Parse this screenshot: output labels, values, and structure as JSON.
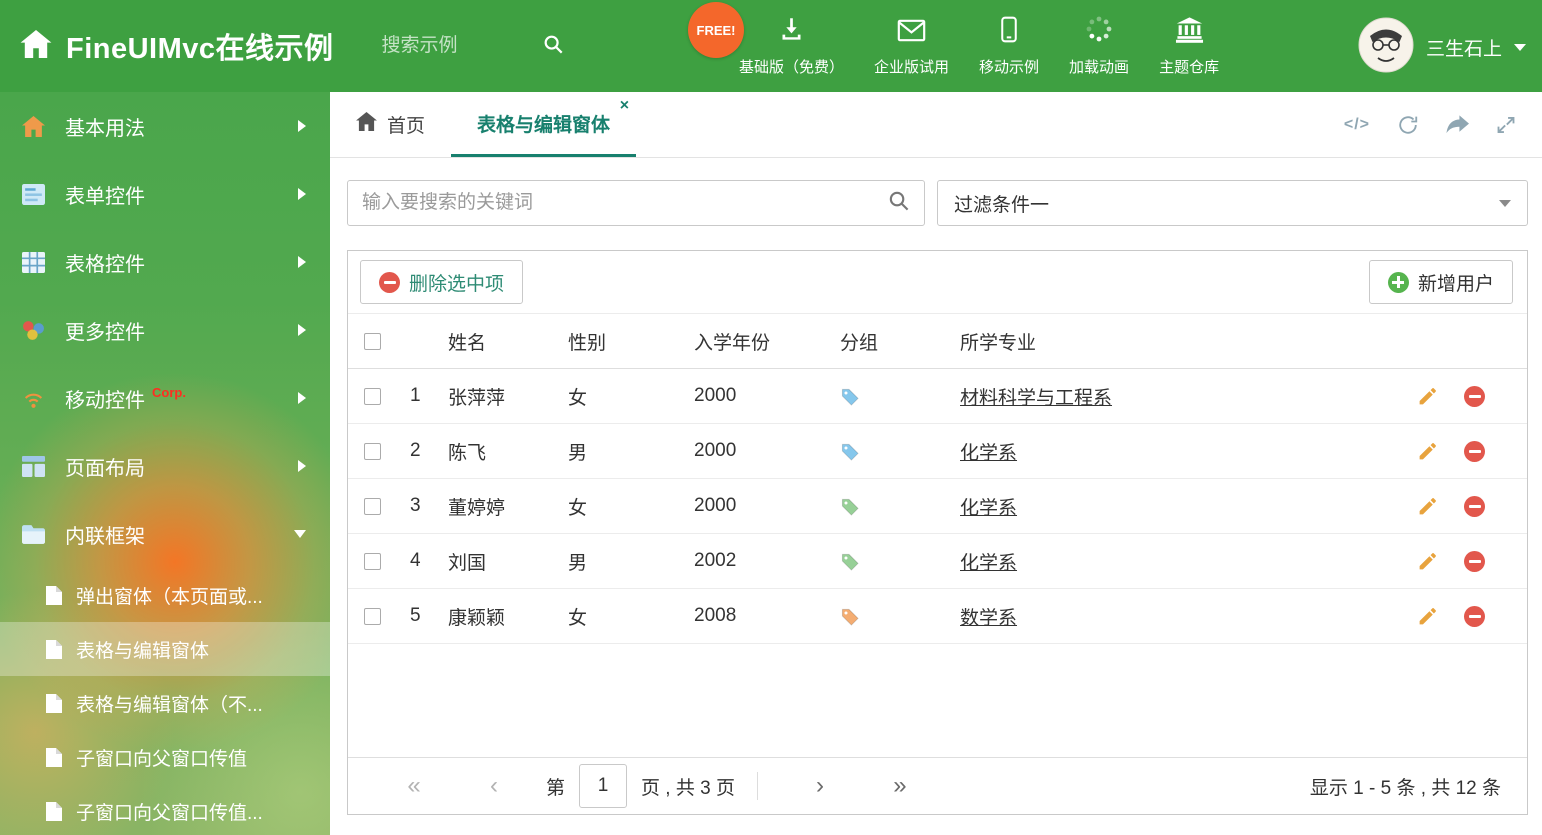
{
  "colors": {
    "header_green": "#3ea041",
    "accent_teal": "#18806e",
    "tag_blue": "#85c7ec",
    "tag_green": "#97d097",
    "tag_orange": "#f4ad72",
    "free_badge_orange": "#f4672b"
  },
  "header": {
    "title": "FineUIMvc在线示例",
    "search_placeholder": "搜索示例",
    "free_badge": "FREE!",
    "nav": [
      {
        "label": "基础版（免费）",
        "icon": "download-icon"
      },
      {
        "label": "企业版试用",
        "icon": "envelope-icon"
      },
      {
        "label": "移动示例",
        "icon": "mobile-icon"
      },
      {
        "label": "加载动画",
        "icon": "spinner-icon"
      },
      {
        "label": "主题仓库",
        "icon": "bank-icon"
      }
    ],
    "user_name": "三生石上"
  },
  "sidebar": {
    "items": [
      {
        "label": "基本用法"
      },
      {
        "label": "表单控件"
      },
      {
        "label": "表格控件"
      },
      {
        "label": "更多控件"
      },
      {
        "label": "移动控件",
        "badge": "Corp."
      },
      {
        "label": "页面布局"
      },
      {
        "label": "内联框架"
      }
    ],
    "subitems": [
      {
        "label": "弹出窗体（本页面或..."
      },
      {
        "label": "表格与编辑窗体"
      },
      {
        "label": "表格与编辑窗体（不..."
      },
      {
        "label": "子窗口向父窗口传值"
      },
      {
        "label": "子窗口向父窗口传值..."
      }
    ]
  },
  "tabbar": {
    "home": "首页",
    "active": "表格与编辑窗体",
    "close": "×",
    "code_icon_text": "</>"
  },
  "filters": {
    "search_placeholder": "输入要搜索的关键词",
    "dropdown_value": "过滤条件一"
  },
  "toolbar": {
    "delete": "删除选中项",
    "add": "新增用户"
  },
  "table": {
    "headers": {
      "name": "姓名",
      "gender": "性别",
      "year": "入学年份",
      "group": "分组",
      "major": "所学专业"
    },
    "rows": [
      {
        "num": "1",
        "name": "张萍萍",
        "gender": "女",
        "year": "2000",
        "tag_color": "#85c7ec",
        "major": "材料科学与工程系"
      },
      {
        "num": "2",
        "name": "陈飞",
        "gender": "男",
        "year": "2000",
        "tag_color": "#85c7ec",
        "major": "化学系"
      },
      {
        "num": "3",
        "name": "董婷婷",
        "gender": "女",
        "year": "2000",
        "tag_color": "#97d097",
        "major": "化学系"
      },
      {
        "num": "4",
        "name": "刘国",
        "gender": "男",
        "year": "2002",
        "tag_color": "#97d097",
        "major": "化学系"
      },
      {
        "num": "5",
        "name": "康颖颖",
        "gender": "女",
        "year": "2008",
        "tag_color": "#f4ad72",
        "major": "数学系"
      }
    ]
  },
  "pagination": {
    "first": "«",
    "prev": "‹",
    "page_label_pre": "第",
    "page": "1",
    "page_label_post": "页 , 共 3 页",
    "next": "›",
    "last": "»",
    "summary": "显示 1 - 5 条 , 共 12 条"
  }
}
